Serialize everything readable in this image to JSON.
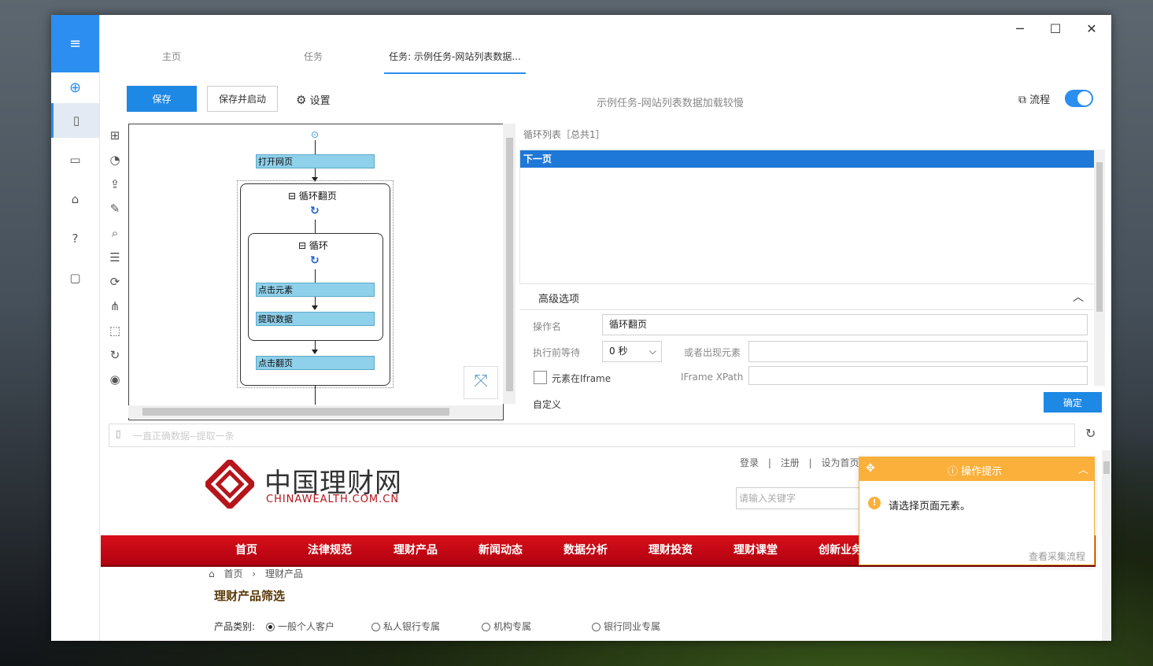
{
  "window": {
    "tabs": [
      {
        "label": "主页"
      },
      {
        "label": "任务"
      },
      {
        "label": "任务: 示例任务-网站列表数据..."
      }
    ],
    "controls": {
      "minimize": "─",
      "maximize": "☐",
      "close": "✕"
    }
  },
  "toolbar": {
    "save_label": "保存",
    "save_start_label": "保存并启动",
    "settings_label": "设置",
    "task_title": "示例任务-网站列表数据加载较慢",
    "flow_label": "流程",
    "flow_toggle_on": true
  },
  "flow": {
    "nodes": {
      "open_page": "打开网页",
      "loop_page": "循环翻页",
      "loop": "循环",
      "click_element": "点击元素",
      "extract_data": "提取数据",
      "click_next": "点击翻页"
    }
  },
  "right_panel": {
    "list_header": "循环列表［总共1］",
    "list_items": [
      "下一页"
    ],
    "advanced_label": "高级选项",
    "op_name_label": "操作名",
    "op_name_value": "循环翻页",
    "wait_label": "执行前等待",
    "wait_value": "0 秒",
    "or_element_label": "或者出现元素",
    "iframe_check_label": "元素在Iframe",
    "iframe_xpath_label": "IFrame XPath",
    "custom_label": "自定义",
    "confirm_label": "确定"
  },
  "url_bar": {
    "url": "一直正确数据--提取一条"
  },
  "website": {
    "logo_cn": "中国理财网",
    "logo_en": "CHINAWEALTH.COM.CN",
    "top_links": [
      "登录",
      "注册",
      "设为首页"
    ],
    "search_placeholder": "请输入关键字",
    "nav": [
      "首页",
      "法律规范",
      "理财产品",
      "新闻动态",
      "数据分析",
      "理财投资",
      "理财课堂",
      "创新业务"
    ],
    "breadcrumb": [
      "首页",
      "理财产品"
    ],
    "section_title": "理财产品筛选",
    "filter_label": "产品类别:",
    "filter_options": [
      "一般个人客户",
      "私人银行专属",
      "机构专属",
      "银行同业专属"
    ],
    "filter_selected": 0
  },
  "tip_popup": {
    "title": "操作提示",
    "message": "请选择页面元素。",
    "link": "查看采集流程"
  },
  "colors": {
    "accent": "#1e88e5",
    "nav_red": "#c8101a",
    "popup_orange": "#fbb03b"
  }
}
